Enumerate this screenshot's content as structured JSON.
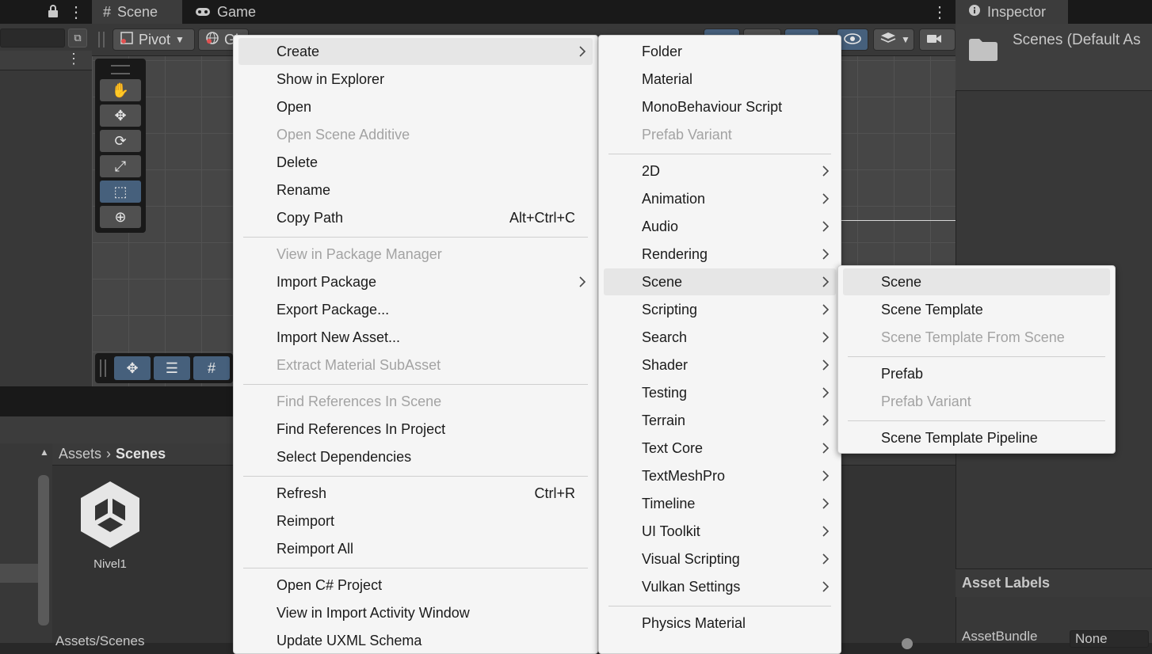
{
  "tabs": {
    "scene": "Scene",
    "game": "Game",
    "inspector": "Inspector"
  },
  "scene_toolbar": {
    "pivot": "Pivot",
    "global": "Gl"
  },
  "project": {
    "breadcrumb_root": "Assets",
    "breadcrumb_current": "Scenes",
    "asset_name": "Nivel1",
    "footer_path": "Assets/Scenes"
  },
  "inspector": {
    "title": "Scenes (Default As",
    "asset_labels": "Asset Labels",
    "asset_bundle": "AssetBundle",
    "asset_bundle_value": "None"
  },
  "context_menu": {
    "items": [
      {
        "label": "Create",
        "submenu": true,
        "highlighted": true
      },
      {
        "label": "Show in Explorer"
      },
      {
        "label": "Open"
      },
      {
        "label": "Open Scene Additive",
        "disabled": true
      },
      {
        "label": "Delete"
      },
      {
        "label": "Rename"
      },
      {
        "label": "Copy Path",
        "shortcut": "Alt+Ctrl+C"
      },
      {
        "separator": true
      },
      {
        "label": "View in Package Manager",
        "disabled": true
      },
      {
        "label": "Import Package",
        "submenu": true
      },
      {
        "label": "Export Package..."
      },
      {
        "label": "Import New Asset..."
      },
      {
        "label": "Extract Material SubAsset",
        "disabled": true
      },
      {
        "separator": true
      },
      {
        "label": "Find References In Scene",
        "disabled": true
      },
      {
        "label": "Find References In Project"
      },
      {
        "label": "Select Dependencies"
      },
      {
        "separator": true
      },
      {
        "label": "Refresh",
        "shortcut": "Ctrl+R"
      },
      {
        "label": "Reimport"
      },
      {
        "label": "Reimport All"
      },
      {
        "separator": true
      },
      {
        "label": "Open C# Project"
      },
      {
        "label": "View in Import Activity Window"
      },
      {
        "label": "Update UXML Schema"
      }
    ]
  },
  "create_menu": {
    "items": [
      {
        "label": "Folder"
      },
      {
        "label": "Material"
      },
      {
        "label": "MonoBehaviour Script"
      },
      {
        "label": "Prefab Variant",
        "disabled": true
      },
      {
        "separator": true
      },
      {
        "label": "2D",
        "submenu": true
      },
      {
        "label": "Animation",
        "submenu": true
      },
      {
        "label": "Audio",
        "submenu": true
      },
      {
        "label": "Rendering",
        "submenu": true
      },
      {
        "label": "Scene",
        "submenu": true,
        "highlighted": true
      },
      {
        "label": "Scripting",
        "submenu": true
      },
      {
        "label": "Search",
        "submenu": true
      },
      {
        "label": "Shader",
        "submenu": true
      },
      {
        "label": "Testing",
        "submenu": true
      },
      {
        "label": "Terrain",
        "submenu": true
      },
      {
        "label": "Text Core",
        "submenu": true
      },
      {
        "label": "TextMeshPro",
        "submenu": true
      },
      {
        "label": "Timeline",
        "submenu": true
      },
      {
        "label": "UI Toolkit",
        "submenu": true
      },
      {
        "label": "Visual Scripting",
        "submenu": true
      },
      {
        "label": "Vulkan Settings",
        "submenu": true
      },
      {
        "separator": true
      },
      {
        "label": "Physics Material"
      }
    ]
  },
  "scene_menu": {
    "items": [
      {
        "label": "Scene",
        "highlighted": true
      },
      {
        "label": "Scene Template"
      },
      {
        "label": "Scene Template From Scene",
        "disabled": true
      },
      {
        "separator": true
      },
      {
        "label": "Prefab"
      },
      {
        "label": "Prefab Variant",
        "disabled": true
      },
      {
        "separator": true
      },
      {
        "label": "Scene Template Pipeline"
      }
    ]
  }
}
